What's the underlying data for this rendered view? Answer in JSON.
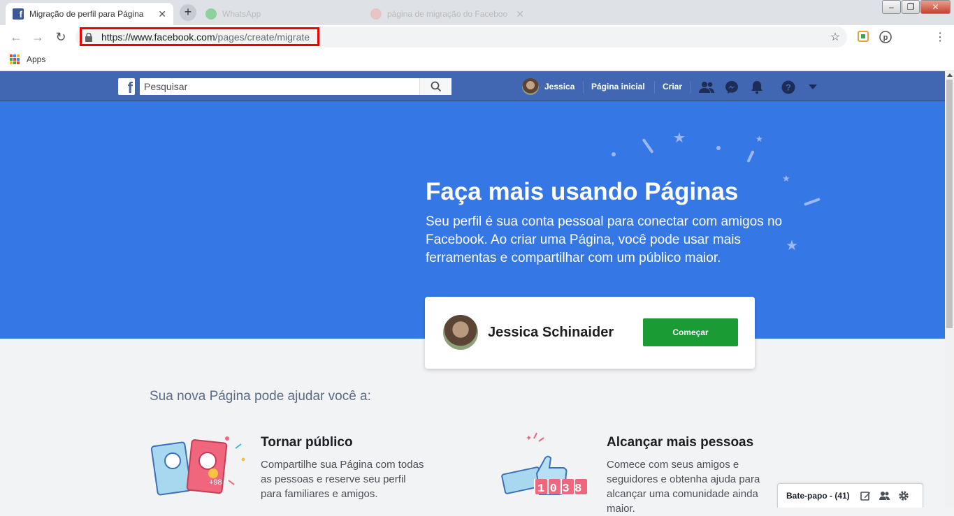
{
  "browser": {
    "tabs": [
      {
        "title": "Migração de perfil para Página",
        "active": true
      },
      {
        "title": "WhatsApp",
        "active": false
      },
      {
        "title": "página de migração do Faceboo",
        "active": false
      }
    ],
    "new_tab_label": "+",
    "url_domain": "https://www.facebook.com",
    "url_path": "/pages/create/migrate",
    "bookmarks": {
      "apps_label": "Apps"
    },
    "window_controls": {
      "minimize": "–",
      "maximize": "❐",
      "close": "✕"
    }
  },
  "fb_header": {
    "logo": "f",
    "search_placeholder": "Pesquisar",
    "user_name": "Jessica",
    "home_label": "Página inicial",
    "create_label": "Criar",
    "brand_color": "#4267b2"
  },
  "hero": {
    "title": "Faça mais usando Páginas",
    "description": "Seu perfil é sua conta pessoal para conectar com amigos no Facebook. Ao criar uma Página, você pode usar mais ferramentas e compartilhar com um público maior.",
    "bg_color": "#3578e5"
  },
  "profile_card": {
    "name": "Jessica Schinaider",
    "button_label": "Começar",
    "button_color": "#1a9b34"
  },
  "benefits": {
    "heading": "Sua nova Página pode ajudar você a:",
    "items": [
      {
        "title": "Tornar público",
        "text": "Compartilhe sua Página com todas as pessoas e reserve seu perfil para familiares e amigos.",
        "illustration_badge": "+98"
      },
      {
        "title": "Alcançar mais pessoas",
        "text": "Comece com seus amigos e seguidores e obtenha ajuda para alcançar uma comunidade ainda maior.",
        "illustration_digits": "1038"
      }
    ]
  },
  "chat": {
    "label": "Bate-papo - (41)"
  }
}
